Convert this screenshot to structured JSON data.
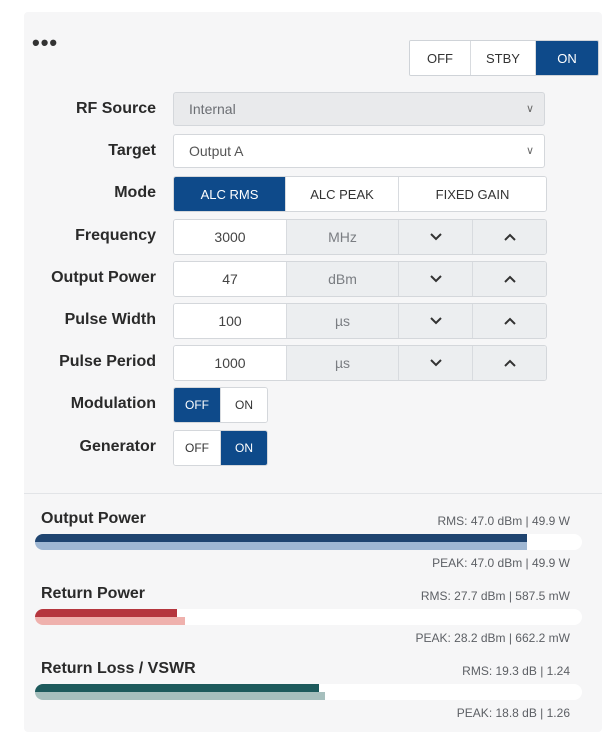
{
  "header": {
    "menu_icon": "more-horizontal-icon",
    "power_modes": [
      "OFF",
      "STBY",
      "ON"
    ],
    "active_power_mode": "ON"
  },
  "form": {
    "rf_source": {
      "label": "RF Source",
      "value": "Internal"
    },
    "target": {
      "label": "Target",
      "value": "Output A"
    },
    "mode": {
      "label": "Mode",
      "options": [
        "ALC RMS",
        "ALC PEAK",
        "FIXED GAIN"
      ],
      "selected": "ALC RMS"
    },
    "frequency": {
      "label": "Frequency",
      "value": "3000",
      "unit": "MHz"
    },
    "output_power": {
      "label": "Output Power",
      "value": "47",
      "unit": "dBm"
    },
    "pulse_width": {
      "label": "Pulse Width",
      "value": "100",
      "unit": "µs"
    },
    "pulse_period": {
      "label": "Pulse Period",
      "value": "1000",
      "unit": "µs"
    },
    "modulation": {
      "label": "Modulation",
      "options": [
        "OFF",
        "ON"
      ],
      "selected": "OFF"
    },
    "generator": {
      "label": "Generator",
      "options": [
        "OFF",
        "ON"
      ],
      "selected": "ON"
    }
  },
  "meters": [
    {
      "title": "Output Power",
      "rms_text": "RMS: 47.0 dBm | 49.9 W",
      "peak_text": "PEAK: 47.0 dBm | 49.9 W",
      "rms_fraction": 0.9,
      "peak_fraction": 0.9,
      "rms_color": "#1f4470",
      "peak_color": "#9fb7d3"
    },
    {
      "title": "Return Power",
      "rms_text": "RMS: 27.7 dBm | 587.5 mW",
      "peak_text": "PEAK: 28.2 dBm | 662.2 mW",
      "rms_fraction": 0.26,
      "peak_fraction": 0.275,
      "rms_color": "#b5363e",
      "peak_color": "#efb1ad"
    },
    {
      "title": "Return Loss / VSWR",
      "rms_text": "RMS: 19.3 dB | 1.24",
      "peak_text": "PEAK: 18.8 dB | 1.26",
      "rms_fraction": 0.52,
      "peak_fraction": 0.53,
      "rms_color": "#1d5a5c",
      "peak_color": "#a6bfbd"
    }
  ],
  "colors": {
    "accent": "#0e4a8a"
  }
}
